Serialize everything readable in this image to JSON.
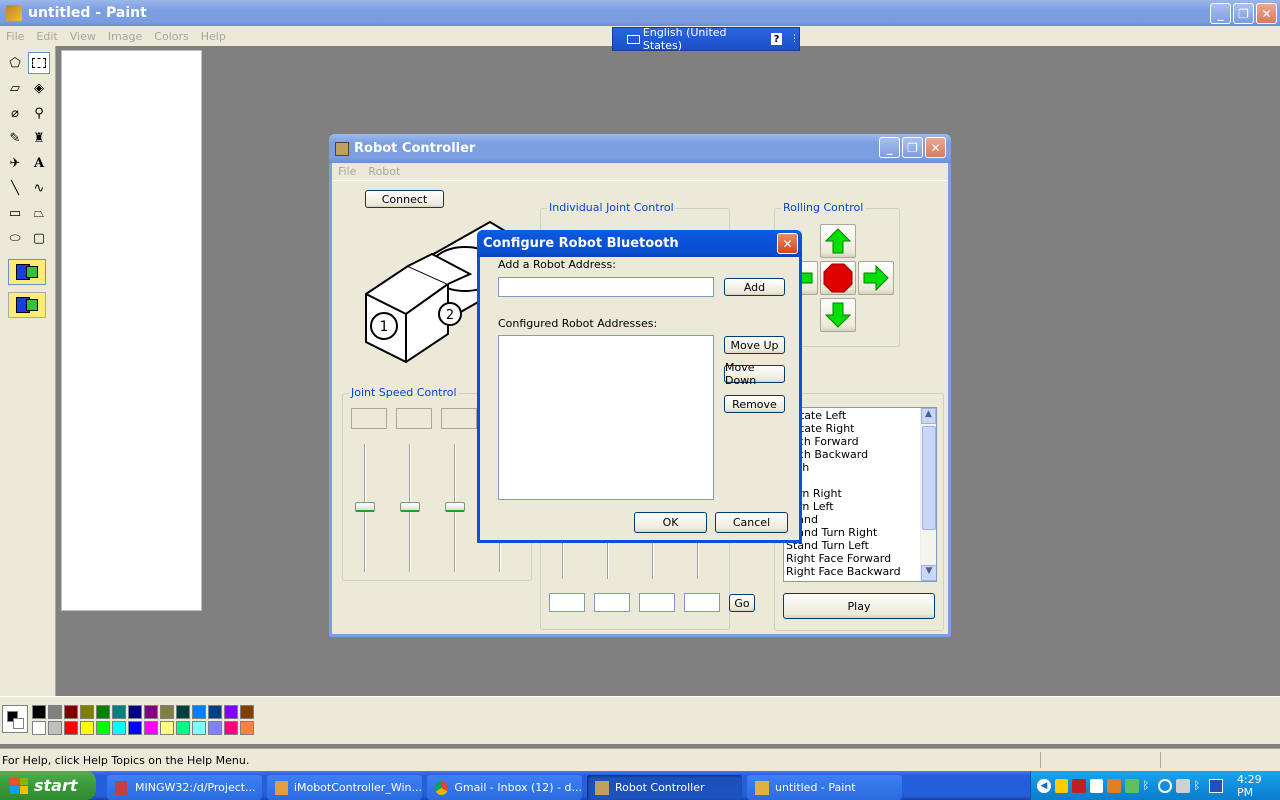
{
  "paint": {
    "title": "untitled - Paint",
    "menu": [
      "File",
      "Edit",
      "View",
      "Image",
      "Colors",
      "Help"
    ],
    "status": "For Help, click Help Topics on the Help Menu.",
    "palette_top": [
      "#000000",
      "#808080",
      "#800000",
      "#808000",
      "#008000",
      "#008080",
      "#000080",
      "#800080",
      "#808040",
      "#004040",
      "#0080ff",
      "#004080",
      "#8000ff",
      "#804000"
    ],
    "palette_bottom": [
      "#ffffff",
      "#c0c0c0",
      "#ff0000",
      "#ffff00",
      "#00ff00",
      "#00ffff",
      "#0000ff",
      "#ff00ff",
      "#ffff80",
      "#00ff80",
      "#80ffff",
      "#8080ff",
      "#ff0080",
      "#ff8040"
    ]
  },
  "language_bar": {
    "label": "English (United States)",
    "help": "?"
  },
  "robot_controller": {
    "title": "Robot Controller",
    "menu": [
      "File",
      "Robot"
    ],
    "connect_label": "Connect",
    "individual_joint_label": "Individual Joint Control",
    "rolling_control_label": "Rolling Control",
    "joint_speed_label": "Joint Speed Control",
    "go_label": "Go",
    "play_label": "Play",
    "motions": [
      "Rotate Left",
      "Rotate Right",
      "Arch Forward",
      "Arch Backward",
      "Inch",
      "",
      "Turn Right",
      "Turn Left",
      "Stand",
      "Stand Turn Right",
      "Stand Turn Left",
      "Right Face Forward",
      "Right Face Backward"
    ],
    "module_labels": [
      "1",
      "2"
    ]
  },
  "dialog": {
    "title": "Configure Robot Bluetooth",
    "add_label": "Add a Robot Address:",
    "add_button": "Add",
    "configured_label": "Configured Robot Addresses:",
    "move_up": "Move Up",
    "move_down": "Move Down",
    "remove": "Remove",
    "ok": "OK",
    "cancel": "Cancel"
  },
  "taskbar": {
    "start": "start",
    "items": [
      "MINGW32:/d/Project...",
      "iMobotController_Win...",
      "Gmail - Inbox (12) - d...",
      "Robot Controller",
      "untitled - Paint"
    ],
    "clock": "4:29 PM"
  },
  "colors": {
    "accent": "#0a5ee8",
    "taskbar": "#245edb",
    "start": "#3c9a3c",
    "arrow_green": "#00e000",
    "stop_red": "#e00000"
  }
}
